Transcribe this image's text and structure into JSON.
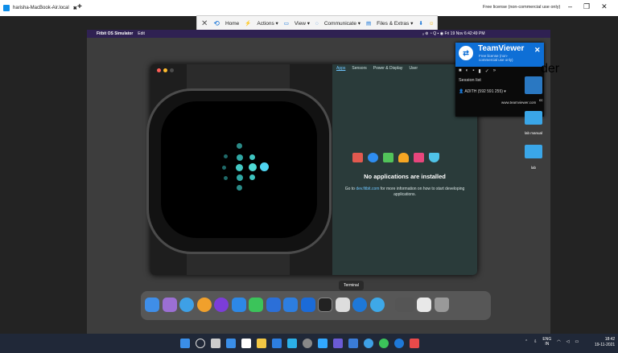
{
  "browser_tab": {
    "title": "harisha-MacBook-Air.local",
    "close": "✖",
    "new_tab": "+"
  },
  "window": {
    "license": "Free license (non-commercial use only)",
    "minimize": "–",
    "restore": "❐",
    "close": "✕"
  },
  "toolbar": {
    "close": "✕",
    "home": "Home",
    "actions": "Actions ▾",
    "view": "View ▾",
    "communicate": "Communicate ▾",
    "files": "Files & Extras ▾",
    "download": "⬇"
  },
  "mac_menubar": {
    "apple": "",
    "app": "Fitbit OS Simulator",
    "edit": "Edit",
    "status": "ₒ  ⊚  ◔  Q  ▪  ◉  Fri 19 Nov  6:42:49 PM"
  },
  "simulator": {
    "tabs": [
      "Apps",
      "Sensors",
      "Power & Display",
      "User"
    ],
    "no_apps_title": "No applications are installed",
    "hint_prefix": "Go to ",
    "hint_link": "dev.fitbit.com",
    "hint_suffix": " for more information on how to start developing applications."
  },
  "teamviewer_popup": {
    "title": "TeamViewer",
    "subtitle": "Free license (non-commercial use only)",
    "close": "✕",
    "session_list": "Session list",
    "user": "ADITH (592 591 255) ▾",
    "url": "www.teamviewer.com"
  },
  "desktop": {
    "folders": [
      {
        "label": "lab manual"
      },
      {
        "label": "lab"
      }
    ],
    "partial_labels": [
      "der",
      "cc"
    ]
  },
  "dock": {
    "tooltip": "Terminal"
  },
  "taskbar": {
    "lang_top": "ENG",
    "lang_bottom": "IN",
    "time": "18:42",
    "date": "19-11-2021"
  }
}
